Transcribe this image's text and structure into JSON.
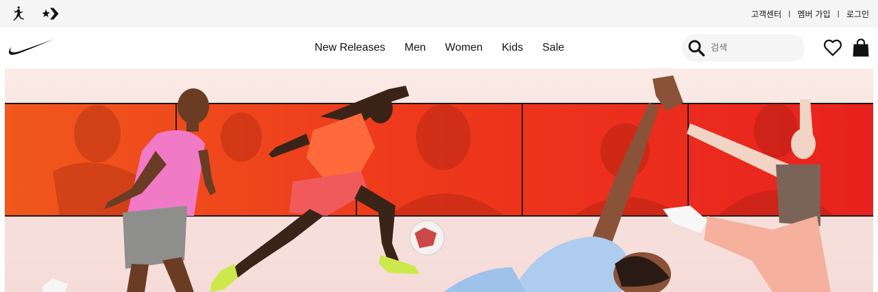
{
  "topbar": {
    "brands": [
      {
        "name": "jordan-logo-icon"
      },
      {
        "name": "converse-logo-icon"
      }
    ],
    "links": [
      {
        "label": "고객센터"
      },
      {
        "label": "멤버 가입"
      },
      {
        "label": "로그인"
      }
    ],
    "separator": "|"
  },
  "nav": {
    "logo": "nike-swoosh-icon",
    "menu": [
      {
        "label": "New Releases"
      },
      {
        "label": "Men"
      },
      {
        "label": "Women"
      },
      {
        "label": "Kids"
      },
      {
        "label": "Sale"
      }
    ],
    "search": {
      "placeholder": "검색",
      "value": ""
    },
    "icons": [
      "heart-icon",
      "shopping-bag-icon"
    ]
  },
  "hero": {
    "image": "athletes-campaign-banner",
    "colors": {
      "panel_red": "#e8321e",
      "panel_orange": "#f0501e",
      "background": "#f7e0dc"
    }
  }
}
